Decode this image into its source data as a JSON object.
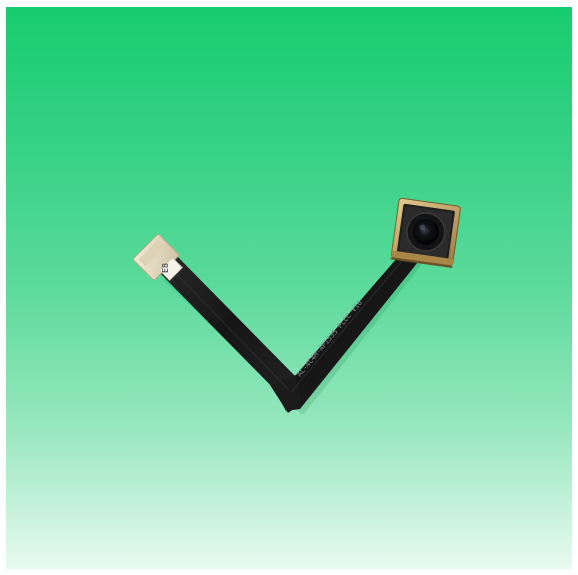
{
  "product_photo": {
    "subject": "camera-module-with-flex-cable",
    "connector_label": "E8",
    "cable_marking": "AL-4C4M-AP1535 PLCC V16",
    "colors": {
      "background_top": "#17cc70",
      "background_bottom": "#e8faf0",
      "flex_cable": "#1a1a1a",
      "connector": "#e8dfc9",
      "module_frame": "#c9a86a",
      "lens": "#0d0d0d"
    }
  }
}
